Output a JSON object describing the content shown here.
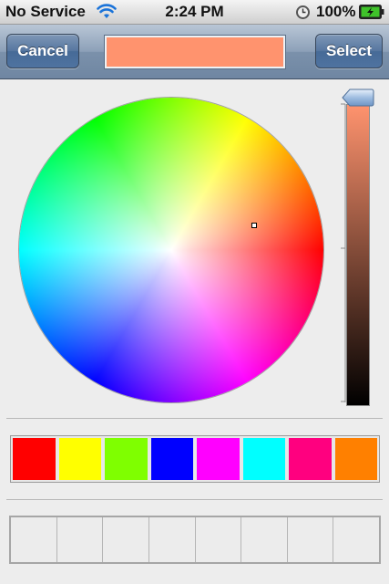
{
  "status_bar": {
    "carrier": "No Service",
    "time": "2:24 PM",
    "battery_percent": "100%",
    "icons": [
      "wifi-icon",
      "alarm-icon",
      "battery-charging-icon"
    ]
  },
  "nav_bar": {
    "cancel_label": "Cancel",
    "select_label": "Select",
    "selected_color": "#ff936e"
  },
  "picker": {
    "brightness_level": 1.0,
    "selected_hue_label": "salmon"
  },
  "presets": {
    "colors": [
      "#ff0000",
      "#ffff00",
      "#7fff00",
      "#0000ff",
      "#ff00ff",
      "#00ffff",
      "#ff007f",
      "#ff8000"
    ]
  },
  "custom_slots": {
    "count": 8
  }
}
